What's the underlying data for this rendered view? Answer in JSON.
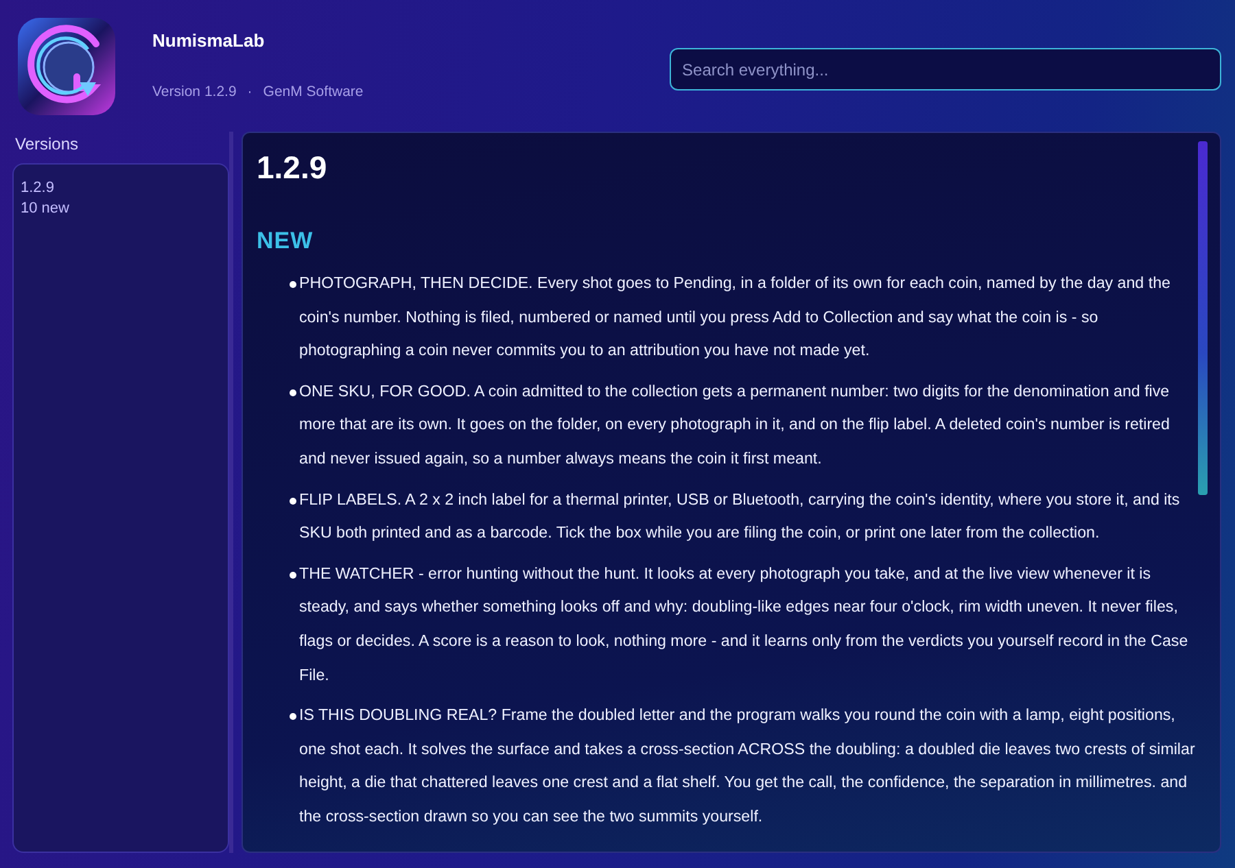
{
  "app": {
    "name": "NumismaLab",
    "version": "Version 1.2.9",
    "separator": "·",
    "publisher": "GenM Software"
  },
  "search": {
    "placeholder": "Search everything..."
  },
  "sidebar": {
    "title": "Versions",
    "items": [
      {
        "version": "1.2.9",
        "count": "10 new",
        "selected": true
      }
    ]
  },
  "release": {
    "title": "1.2.9",
    "sections": [
      {
        "heading": "NEW",
        "items": [
          "PHOTOGRAPH, THEN DECIDE. Every shot goes to Pending, in a folder of its own for each coin, named by the day and the coin's number. Nothing is filed, numbered or named until you press Add to Collection and say what the coin is - so photographing a coin never commits you to an attribution you have not made yet.",
          "ONE SKU, FOR GOOD. A coin admitted to the collection gets a permanent number: two digits for the denomination and five more that are its own. It goes on the folder, on every photograph in it, and on the flip label. A deleted coin's number is retired and never issued again, so a number always means the coin it first meant.",
          "FLIP LABELS. A 2 x 2 inch label for a thermal printer, USB or Bluetooth, carrying the coin's identity, where you store it, and its SKU both printed and as a barcode. Tick the box while you are filing the coin, or print one later from the collection.",
          "THE WATCHER - error hunting without the hunt. It looks at every photograph you take, and at the live view whenever it is steady, and says whether something looks off and why: doubling-like edges near four o'clock, rim width uneven. It never files, flags or decides. A score is a reason to look, nothing more - and it learns only from the verdicts you yourself record in the Case File.",
          "IS THIS DOUBLING REAL? Frame the doubled letter and the program walks you round the coin with a lamp, eight positions, one shot each. It solves the surface and takes a cross-section ACROSS the doubling: a doubled die leaves two crests of similar height, a die that chattered leaves one crest and a flat shelf. You get the call, the confidence, the separation in millimetres. and the cross-section drawn so you can see the two summits yourself."
        ]
      }
    ]
  }
}
